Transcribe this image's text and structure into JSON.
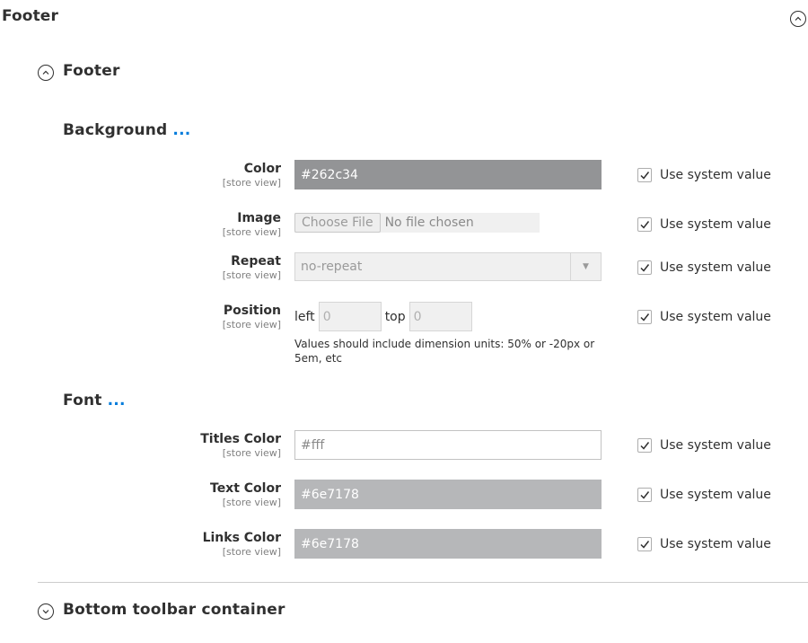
{
  "page": {
    "title": "Footer"
  },
  "section": {
    "title": "Footer"
  },
  "background_group": {
    "title": "Background",
    "dots": "..."
  },
  "font_group": {
    "title": "Font",
    "dots": "..."
  },
  "scope_label": "[store view]",
  "use_system_value_label": "Use system value",
  "fields": {
    "color": {
      "label": "Color",
      "value": "#262c34",
      "use_system_value": true
    },
    "image": {
      "label": "Image",
      "button": "Choose File",
      "file_status": "No file chosen",
      "use_system_value": true
    },
    "repeat": {
      "label": "Repeat",
      "selected": "no-repeat",
      "use_system_value": true
    },
    "position": {
      "label": "Position",
      "left_label": "left",
      "left_value": "0",
      "top_label": "top",
      "top_value": "0",
      "note": "Values should include dimension units: 50% or -20px or 5em, etc",
      "use_system_value": true
    },
    "titles_color": {
      "label": "Titles Color",
      "value": "#fff",
      "use_system_value": true
    },
    "text_color": {
      "label": "Text Color",
      "value": "#6e7178",
      "use_system_value": true
    },
    "links_color": {
      "label": "Links Color",
      "value": "#6e7178",
      "use_system_value": true
    }
  },
  "bottom_section": {
    "title": "Bottom toolbar container"
  },
  "colors": {
    "accent": "#007bdb",
    "color_field_bg": "#939496",
    "text_color_field_bg": "#b6b7b9"
  }
}
